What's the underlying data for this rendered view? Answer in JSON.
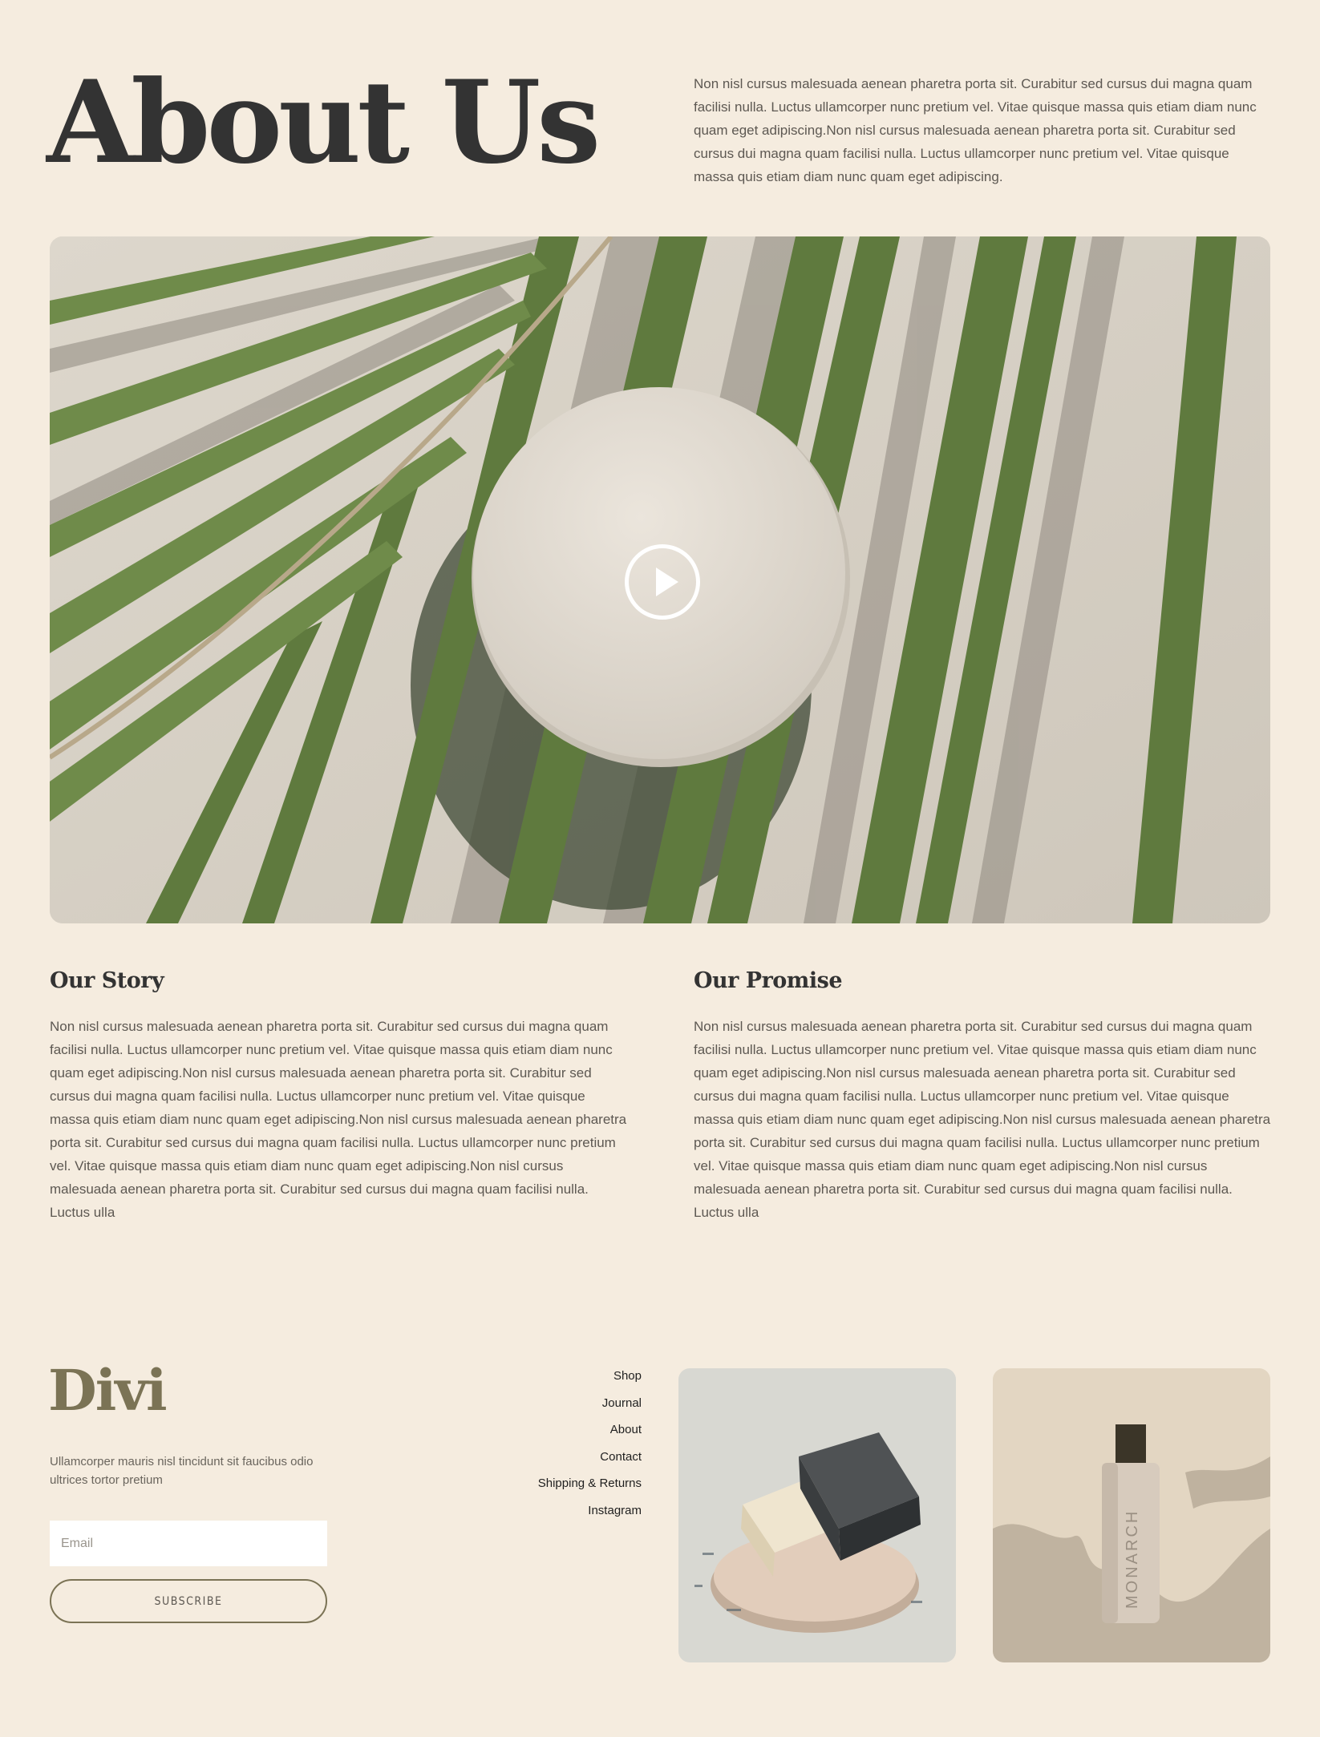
{
  "hero": {
    "title": "About Us",
    "intro": "Non nisl cursus malesuada aenean pharetra porta sit. Curabitur sed cursus dui magna quam facilisi nulla. Luctus ullamcorper nunc pretium vel. Vitae quisque massa quis etiam diam nunc quam eget adipiscing.Non nisl cursus malesuada aenean pharetra porta sit. Curabitur sed cursus dui magna quam facilisi nulla. Luctus ullamcorper nunc pretium vel. Vitae quisque massa quis etiam diam nunc quam eget adipiscing."
  },
  "video": {
    "play_icon": "play-icon"
  },
  "story": {
    "title": "Our Story",
    "text": "Non nisl cursus malesuada aenean pharetra porta sit. Curabitur sed cursus dui magna quam facilisi nulla. Luctus ullamcorper nunc pretium vel. Vitae quisque massa quis etiam diam nunc quam eget adipiscing.Non nisl cursus malesuada aenean pharetra porta sit. Curabitur sed cursus dui magna quam facilisi nulla. Luctus ullamcorper nunc pretium vel. Vitae quisque massa quis etiam diam nunc quam eget adipiscing.Non nisl cursus malesuada aenean pharetra porta sit. Curabitur sed cursus dui magna quam facilisi nulla. Luctus ullamcorper nunc pretium vel. Vitae quisque massa quis etiam diam nunc quam eget adipiscing.Non nisl cursus malesuada aenean pharetra porta sit. Curabitur sed cursus dui magna quam facilisi nulla. Luctus ulla"
  },
  "promise": {
    "title": "Our Promise",
    "text": "Non nisl cursus malesuada aenean pharetra porta sit. Curabitur sed cursus dui magna quam facilisi nulla. Luctus ullamcorper nunc pretium vel. Vitae quisque massa quis etiam diam nunc quam eget adipiscing.Non nisl cursus malesuada aenean pharetra porta sit. Curabitur sed cursus dui magna quam facilisi nulla. Luctus ullamcorper nunc pretium vel. Vitae quisque massa quis etiam diam nunc quam eget adipiscing.Non nisl cursus malesuada aenean pharetra porta sit. Curabitur sed cursus dui magna quam facilisi nulla. Luctus ullamcorper nunc pretium vel. Vitae quisque massa quis etiam diam nunc quam eget adipiscing.Non nisl cursus malesuada aenean pharetra porta sit. Curabitur sed cursus dui magna quam facilisi nulla. Luctus ulla"
  },
  "footer": {
    "logo": "Divi",
    "tagline": "Ullamcorper mauris nisl tincidunt sit faucibus odio ultrices tortor pretium",
    "email_placeholder": "Email",
    "subscribe_label": "SUBSCRIBE",
    "nav": [
      "Shop",
      "Journal",
      "About",
      "Contact",
      "Shipping & Returns",
      "Instagram"
    ],
    "bottle_text": "MONARCH"
  },
  "colors": {
    "background": "#f5ecdf",
    "heading": "#333333",
    "body_text": "#5d5852",
    "accent": "#7b7355",
    "leaf": "#5f7a3e"
  }
}
